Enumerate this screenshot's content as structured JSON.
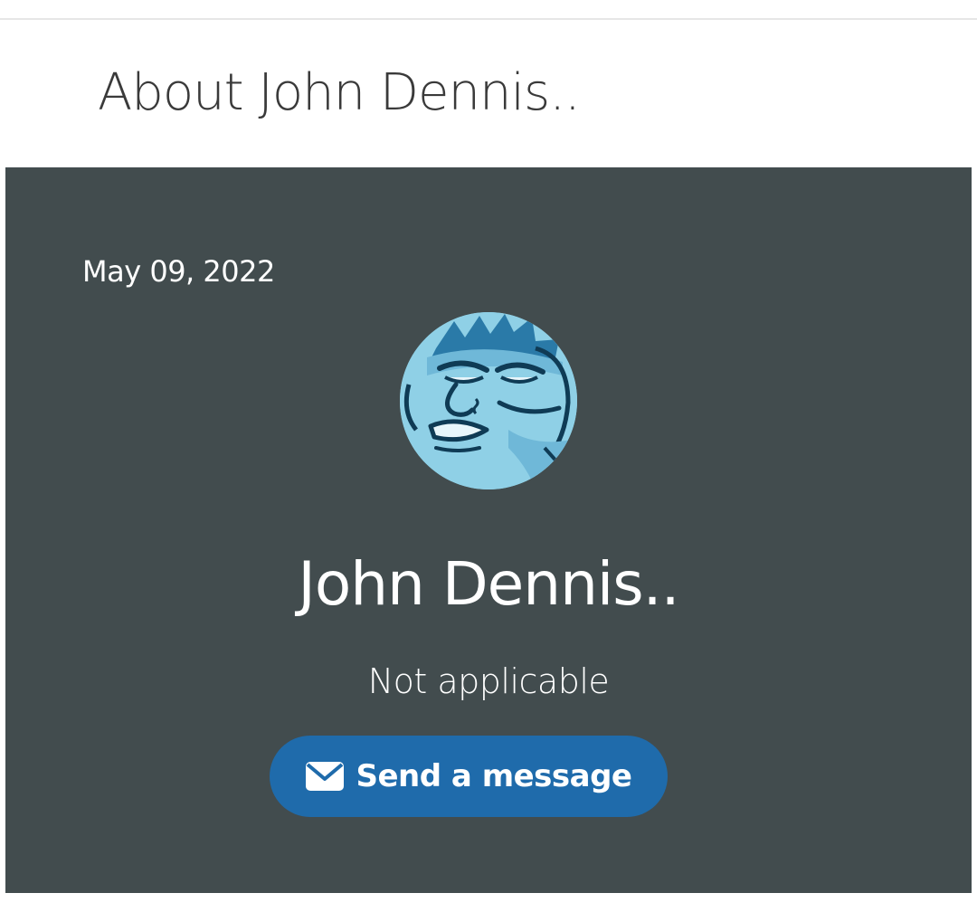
{
  "page": {
    "heading": "About John Dennis.."
  },
  "profile": {
    "date": "May 09, 2022",
    "avatar_icon": "cartoon-monster-avatar-icon",
    "name": "John Dennis..",
    "subtitle": "Not applicable",
    "send_message_label": "Send a message",
    "send_message_icon": "envelope-icon"
  },
  "colors": {
    "card_background": "#424c4e",
    "button_background": "#1f6bab",
    "heading_text": "#3a3a3a",
    "card_text": "#ffffff"
  }
}
